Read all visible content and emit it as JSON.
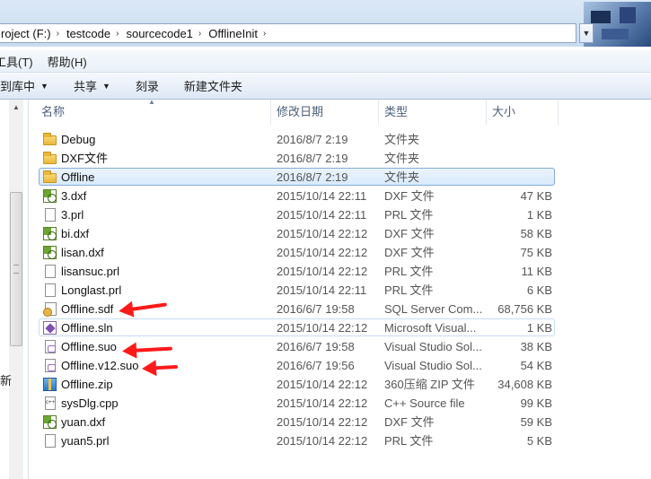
{
  "address": {
    "segments": [
      "roject (F:)",
      "testcode",
      "sourcecode1",
      "OfflineInit"
    ],
    "separator": "›",
    "dropdown_arrow": "▼"
  },
  "menu": {
    "items": [
      "工具(T)",
      "帮助(H)"
    ]
  },
  "toolbar": {
    "include_library": "到库中",
    "share": "共享",
    "burn": "刻录",
    "new_folder": "新建文件夹",
    "arrow": "▼"
  },
  "columns": {
    "name": "名称",
    "date": "修改日期",
    "type": "类型",
    "size": "大小",
    "sort_arrow": "▲"
  },
  "nav": {
    "fragment": "新"
  },
  "files": [
    {
      "name": "Debug",
      "date": "2016/8/7 2:19",
      "type": "文件夹",
      "size": "",
      "icon": "folder"
    },
    {
      "name": "DXF文件",
      "date": "2016/8/7 2:19",
      "type": "文件夹",
      "size": "",
      "icon": "folder"
    },
    {
      "name": "Offline",
      "date": "2016/8/7 2:19",
      "type": "文件夹",
      "size": "",
      "icon": "folder"
    },
    {
      "name": "3.dxf",
      "date": "2015/10/14 22:11",
      "type": "DXF 文件",
      "size": "47 KB",
      "icon": "dxf"
    },
    {
      "name": "3.prl",
      "date": "2015/10/14 22:11",
      "type": "PRL 文件",
      "size": "1 KB",
      "icon": "doc"
    },
    {
      "name": "bi.dxf",
      "date": "2015/10/14 22:12",
      "type": "DXF 文件",
      "size": "58 KB",
      "icon": "dxf"
    },
    {
      "name": "lisan.dxf",
      "date": "2015/10/14 22:12",
      "type": "DXF 文件",
      "size": "75 KB",
      "icon": "dxf"
    },
    {
      "name": "lisansuc.prl",
      "date": "2015/10/14 22:12",
      "type": "PRL 文件",
      "size": "11 KB",
      "icon": "doc"
    },
    {
      "name": "Longlast.prl",
      "date": "2015/10/14 22:11",
      "type": "PRL 文件",
      "size": "6 KB",
      "icon": "doc"
    },
    {
      "name": "Offline.sdf",
      "date": "2016/6/7 19:58",
      "type": "SQL Server Com...",
      "size": "68,756 KB",
      "icon": "sdf"
    },
    {
      "name": "Offline.sln",
      "date": "2015/10/14 22:12",
      "type": "Microsoft Visual...",
      "size": "1 KB",
      "icon": "sln"
    },
    {
      "name": "Offline.suo",
      "date": "2016/6/7 19:58",
      "type": "Visual Studio Sol...",
      "size": "38 KB",
      "icon": "suo"
    },
    {
      "name": "Offline.v12.suo",
      "date": "2016/6/7 19:56",
      "type": "Visual Studio Sol...",
      "size": "54 KB",
      "icon": "suo"
    },
    {
      "name": "Offline.zip",
      "date": "2015/10/14 22:12",
      "type": "360压缩 ZIP 文件",
      "size": "34,608 KB",
      "icon": "zip"
    },
    {
      "name": "sysDlg.cpp",
      "date": "2015/10/14 22:12",
      "type": "C++ Source file",
      "size": "99 KB",
      "icon": "cpp"
    },
    {
      "name": "yuan.dxf",
      "date": "2015/10/14 22:12",
      "type": "DXF 文件",
      "size": "59 KB",
      "icon": "dxf"
    },
    {
      "name": "yuan5.prl",
      "date": "2015/10/14 22:12",
      "type": "PRL 文件",
      "size": "5 KB",
      "icon": "doc"
    }
  ],
  "cpp_icon_text": "c++",
  "accent_colors": {
    "selection": "#d9eafc",
    "annotation_arrow": "#ff1a1a"
  }
}
